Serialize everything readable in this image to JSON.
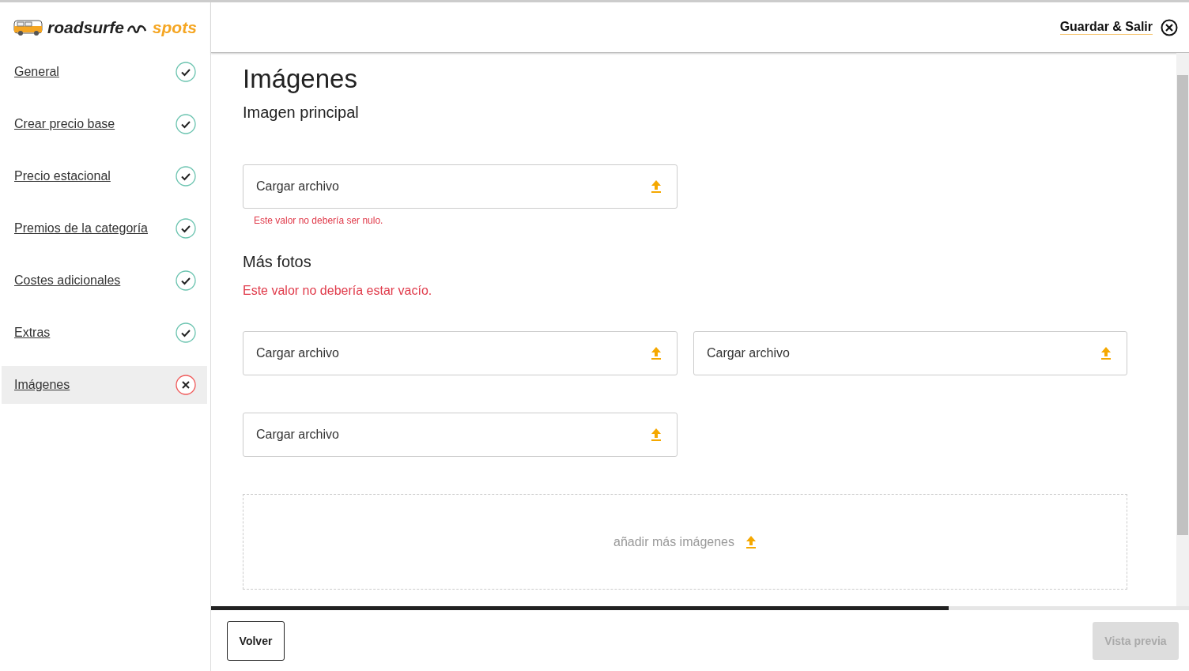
{
  "logo": {
    "name": "roadsurfe",
    "suffix": "spots"
  },
  "sidebar": {
    "items": [
      {
        "label": "General",
        "completed": true,
        "selected": false
      },
      {
        "label": "Crear precio base",
        "completed": true,
        "selected": false
      },
      {
        "label": "Precio estacional",
        "completed": true,
        "selected": false
      },
      {
        "label": "Premios de la categoría",
        "completed": true,
        "selected": false
      },
      {
        "label": "Costes adicionales",
        "completed": true,
        "selected": false
      },
      {
        "label": "Extras",
        "completed": true,
        "selected": false
      },
      {
        "label": "Imágenes",
        "completed": false,
        "selected": true
      }
    ]
  },
  "header": {
    "save_exit": "Guardar & Salir"
  },
  "content": {
    "title": "Imágenes",
    "main_image": {
      "heading": "Imagen principal",
      "upload": "Cargar archivo",
      "error": "Este valor no debería ser nulo."
    },
    "more_photos": {
      "heading": "Más fotos",
      "error": "Este valor no debería estar vacío.",
      "uploads": [
        "Cargar archivo",
        "Cargar archivo",
        "Cargar archivo"
      ],
      "add_more": "añadir más imágenes"
    }
  },
  "progress": {
    "level": 0.754
  },
  "footer": {
    "back": "Volver",
    "preview": "Vista previa",
    "preview_disabled": true
  }
}
